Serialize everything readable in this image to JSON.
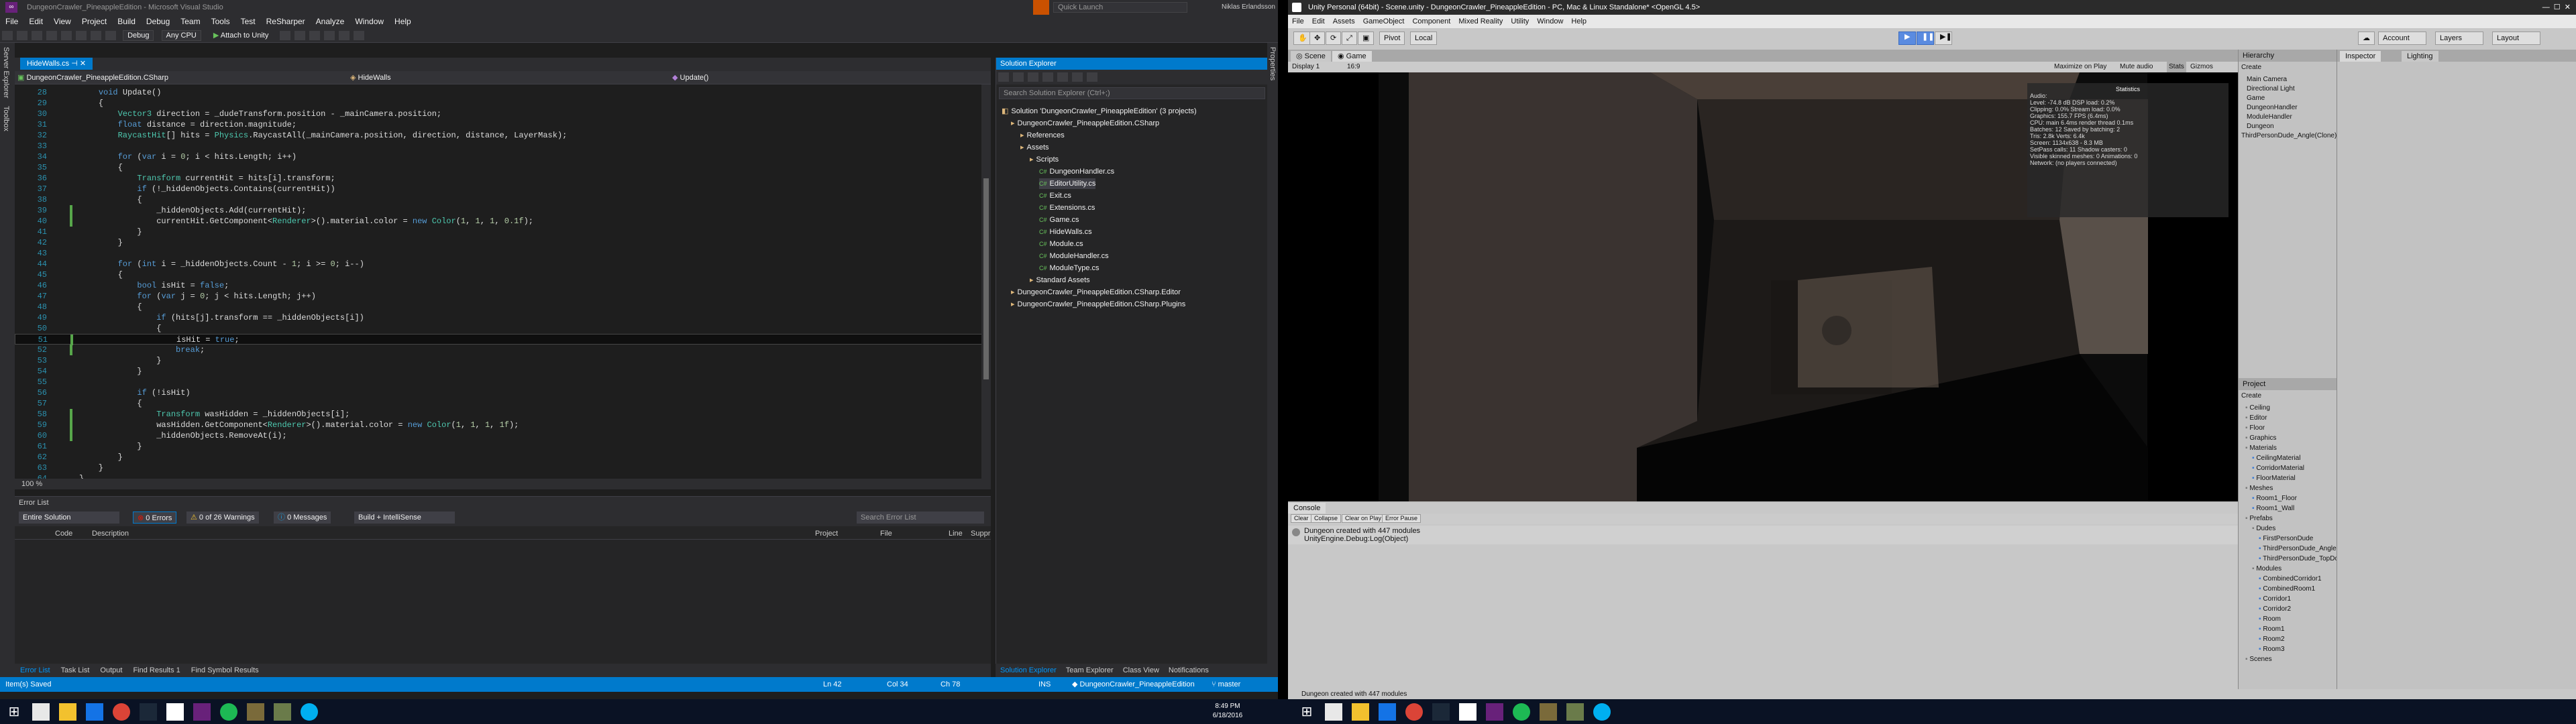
{
  "vs": {
    "window_title": "DungeonCrawler_PineappleEdition - Microsoft Visual Studio",
    "quick_launch": "Quick Launch",
    "user": "Niklas Erlandsson",
    "menu": [
      "File",
      "Edit",
      "View",
      "Project",
      "Build",
      "Debug",
      "Team",
      "Tools",
      "Test",
      "ReSharper",
      "Analyze",
      "Window",
      "Help"
    ],
    "toolbar": {
      "config": "Debug",
      "platform": "Any CPU",
      "attach": "Attach to Unity"
    },
    "side_tabs": [
      "Server Explorer",
      "Toolbox"
    ],
    "doc_tab": "HideWalls.cs",
    "nav": {
      "project": "DungeonCrawler_PineappleEdition.CSharp",
      "class": "HideWalls",
      "member": "Update()"
    },
    "code": [
      {
        "n": "28",
        "t": "    void Update()"
      },
      {
        "n": "29",
        "t": "    {"
      },
      {
        "n": "30",
        "t": "        Vector3 direction = _dudeTransform.position - _mainCamera.position;"
      },
      {
        "n": "31",
        "t": "        float distance = direction.magnitude;"
      },
      {
        "n": "32",
        "t": "        RaycastHit[] hits = Physics.RaycastAll(_mainCamera.position, direction, distance, LayerMask);"
      },
      {
        "n": "33",
        "t": ""
      },
      {
        "n": "34",
        "t": "        for (var i = 0; i < hits.Length; i++)"
      },
      {
        "n": "35",
        "t": "        {"
      },
      {
        "n": "36",
        "t": "            Transform currentHit = hits[i].transform;"
      },
      {
        "n": "37",
        "t": "            if (!_hiddenObjects.Contains(currentHit))"
      },
      {
        "n": "38",
        "t": "            {"
      },
      {
        "n": "39",
        "t": "                _hiddenObjects.Add(currentHit);"
      },
      {
        "n": "40",
        "t": "                currentHit.GetComponent<Renderer>().material.color = new Color(1, 1, 1, 0.1f);"
      },
      {
        "n": "41",
        "t": "            }"
      },
      {
        "n": "42",
        "t": "        }"
      },
      {
        "n": "43",
        "t": ""
      },
      {
        "n": "44",
        "t": "        for (int i = _hiddenObjects.Count - 1; i >= 0; i--)"
      },
      {
        "n": "45",
        "t": "        {"
      },
      {
        "n": "46",
        "t": "            bool isHit = false;"
      },
      {
        "n": "47",
        "t": "            for (var j = 0; j < hits.Length; j++)"
      },
      {
        "n": "48",
        "t": "            {"
      },
      {
        "n": "49",
        "t": "                if (hits[j].transform == _hiddenObjects[i])"
      },
      {
        "n": "50",
        "t": "                {"
      },
      {
        "n": "51",
        "t": "                    isHit = true;"
      },
      {
        "n": "52",
        "t": "                    break;"
      },
      {
        "n": "53",
        "t": "                }"
      },
      {
        "n": "54",
        "t": "            }"
      },
      {
        "n": "55",
        "t": ""
      },
      {
        "n": "56",
        "t": "            if (!isHit)"
      },
      {
        "n": "57",
        "t": "            {"
      },
      {
        "n": "58",
        "t": "                Transform wasHidden = _hiddenObjects[i];"
      },
      {
        "n": "59",
        "t": "                wasHidden.GetComponent<Renderer>().material.color = new Color(1, 1, 1, 1f);"
      },
      {
        "n": "60",
        "t": "                _hiddenObjects.RemoveAt(i);"
      },
      {
        "n": "61",
        "t": "            }"
      },
      {
        "n": "62",
        "t": "        }"
      },
      {
        "n": "63",
        "t": "    }"
      },
      {
        "n": "64",
        "t": "}"
      }
    ],
    "zoom": "100 %",
    "error_list": {
      "title": "Error List",
      "scope": "Entire Solution",
      "errors": "0 Errors",
      "warnings": "0 of 26 Warnings",
      "messages": "0 Messages",
      "build": "Build + IntelliSense",
      "search": "Search Error List",
      "columns": [
        "Code",
        "Description",
        "Project",
        "File",
        "Line",
        "Suppr"
      ]
    },
    "bottom_tabs": [
      "Error List",
      "Task List",
      "Output",
      "Find Results 1",
      "Find Symbol Results"
    ],
    "solution_explorer": {
      "title": "Solution Explorer",
      "search": "Search Solution Explorer (Ctrl+;)",
      "items": [
        {
          "t": "Solution 'DungeonCrawler_PineappleEdition' (3 projects)",
          "l": 0
        },
        {
          "t": "DungeonCrawler_PineappleEdition.CSharp",
          "l": 1
        },
        {
          "t": "References",
          "l": 2
        },
        {
          "t": "Assets",
          "l": 2
        },
        {
          "t": "Scripts",
          "l": 3
        },
        {
          "t": "DungeonHandler.cs",
          "l": 4
        },
        {
          "t": "EditorUtility.cs",
          "l": 4
        },
        {
          "t": "Exit.cs",
          "l": 4
        },
        {
          "t": "Extensions.cs",
          "l": 4
        },
        {
          "t": "Game.cs",
          "l": 4
        },
        {
          "t": "HideWalls.cs",
          "l": 4
        },
        {
          "t": "Module.cs",
          "l": 4
        },
        {
          "t": "ModuleHandler.cs",
          "l": 4
        },
        {
          "t": "ModuleType.cs",
          "l": 4
        },
        {
          "t": "Standard Assets",
          "l": 3
        },
        {
          "t": "DungeonCrawler_PineappleEdition.CSharp.Editor",
          "l": 1
        },
        {
          "t": "DungeonCrawler_PineappleEdition.CSharp.Plugins",
          "l": 1
        }
      ],
      "tabs": [
        "Solution Explorer",
        "Team Explorer",
        "Class View",
        "Notifications"
      ]
    },
    "props_tab": "Properties",
    "status": {
      "left": "Item(s) Saved",
      "ln": "Ln 42",
      "col": "Col 34",
      "ch": "Ch 78",
      "ins": "INS",
      "project": "DungeonCrawler_PineappleEdition",
      "branch": "master"
    }
  },
  "unity": {
    "window_title": "Unity Personal (64bit) - Scene.unity - DungeonCrawler_PineappleEdition - PC, Mac & Linux Standalone* <OpenGL 4.5>",
    "menu": [
      "File",
      "Edit",
      "Assets",
      "GameObject",
      "Component",
      "Mixed Reality",
      "Utility",
      "Window",
      "Help"
    ],
    "toolbar": {
      "pivot": "Pivot",
      "local": "Local",
      "account": "Account",
      "layers": "Layers",
      "layout": "Layout"
    },
    "tabs": {
      "scene": "Scene",
      "game": "Game"
    },
    "gamebar": {
      "display": "Display 1",
      "aspect": "16:9",
      "max": "Maximize on Play",
      "mute": "Mute audio",
      "stats": "Stats",
      "gizmos": "Gizmos"
    },
    "stats": {
      "title": "Statistics",
      "lines": [
        "Audio:",
        "Level: -74.8 dB     DSP load: 0.2%",
        "Clipping: 0.0%     Stream load: 0.0%",
        "Graphics:          155.7 FPS (6.4ms)",
        "CPU: main 6.4ms  render thread 0.1ms",
        "Batches: 12     Saved by batching: 2",
        "Tris: 2.8k      Verts: 6.4k",
        "Screen: 1134x638 - 8.3 MB",
        "SetPass calls: 11   Shadow casters: 0",
        "Visible skinned meshes: 0  Animations: 0",
        "Network: (no players connected)"
      ]
    },
    "console": {
      "tab": "Console",
      "buttons": [
        "Clear",
        "Collapse",
        "Clear on Play",
        "Error Pause"
      ],
      "msg1": "Dungeon created with 447 modules",
      "msg2": "UnityEngine.Debug:Log(Object)"
    },
    "hierarchy": {
      "title": "Hierarchy",
      "create": "Create",
      "items": [
        "Main Camera",
        "Directional Light",
        "Game",
        "DungeonHandler",
        "ModuleHandler",
        "Dungeon",
        "ThirdPersonDude_Angle(Clone)"
      ]
    },
    "project": {
      "title": "Project",
      "create": "Create",
      "items": [
        "Ceiling",
        "Editor",
        "Floor",
        "Graphics",
        "Materials",
        "CeilingMaterial",
        "CorridorMaterial",
        "FloorMaterial",
        "Meshes",
        "Room1_Floor",
        "Room1_Wall",
        "Prefabs",
        "Dudes",
        "FirstPersonDude",
        "ThirdPersonDude_Angle",
        "ThirdPersonDude_TopDown",
        "Modules",
        "CombinedCorridor1",
        "CombinedRoom1",
        "Corridor1",
        "Corridor2",
        "Room",
        "Room1",
        "Room2",
        "Room3",
        "Scenes"
      ]
    },
    "inspector": {
      "title": "Inspector",
      "lighting": "Lighting"
    },
    "status": "Dungeon created with 447 modules"
  },
  "taskbar": {
    "time": "8:49 PM",
    "date": "6/18/2016"
  }
}
